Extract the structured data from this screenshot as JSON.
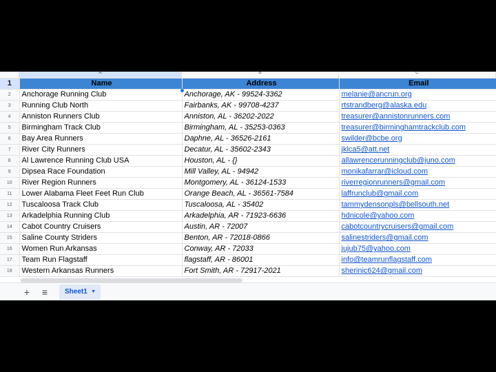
{
  "columns": {
    "a": "A",
    "b": "B",
    "c": "C"
  },
  "header": {
    "row": "1",
    "name": "Name",
    "address": "Address",
    "email": "Email"
  },
  "rows": [
    {
      "n": "2",
      "name": "Anchorage Running Club",
      "address": "Anchorage, AK - 99524-3362",
      "email": "melanie@ancrun.org"
    },
    {
      "n": "3",
      "name": "Running Club North",
      "address": "Fairbanks, AK - 99708-4237",
      "email": "rtstrandberg@alaska.edu"
    },
    {
      "n": "4",
      "name": "Anniston Runners Club",
      "address": "Anniston, AL - 36202-2022",
      "email": "treasurer@annistonrunners.com"
    },
    {
      "n": "5",
      "name": "Birmingham Track Club",
      "address": "Birmingham, AL - 35253-0363",
      "email": "treasurer@birminghamtrackclub.com"
    },
    {
      "n": "6",
      "name": "Bay Area Runners",
      "address": "Daphne, AL - 36526-2161",
      "email": "swilder@bcbe.org"
    },
    {
      "n": "7",
      "name": "River City Runners",
      "address": "Decatur, AL - 35602-2343",
      "email": "jklca5@att.net"
    },
    {
      "n": "8",
      "name": "Al Lawrence Running Club USA",
      "address": "Houston, AL - {}",
      "email": "allawrencerunningclub@juno.com"
    },
    {
      "n": "9",
      "name": "Dipsea Race Foundation",
      "address": "Mill Valley, AL - 94942",
      "email": "monikafarrar@icloud.com"
    },
    {
      "n": "10",
      "name": "River Region Runners",
      "address": "Montgomery, AL - 36124-1533",
      "email": "riverregionrunners@gmail.com"
    },
    {
      "n": "11",
      "name": "Lower Alabama Fleet Feet Run Club",
      "address": "Orange Beach, AL - 36561-7584",
      "email": "laffrunclub@gmail.com"
    },
    {
      "n": "12",
      "name": "Tuscaloosa Track Club",
      "address": "Tuscaloosa, AL - 35402",
      "email": "tammydensonpls@bellsouth.net"
    },
    {
      "n": "13",
      "name": "Arkadelphia Running Club",
      "address": "Arkadelphia, AR - 71923-6636",
      "email": "hdnicole@yahoo.com"
    },
    {
      "n": "14",
      "name": "Cabot Country Cruisers",
      "address": "Austin, AR - 72007",
      "email": "cabotcountrycruisers@gmail.com"
    },
    {
      "n": "15",
      "name": "Saline County Striders",
      "address": "Benton, AR - 72018-0866",
      "email": "salinestriders@gmail.com"
    },
    {
      "n": "16",
      "name": "Women Run Arkansas",
      "address": "Conway, AR - 72033",
      "email": "jujub75@yahoo.com"
    },
    {
      "n": "17",
      "name": "Team Run Flagstaff",
      "address": "flagstaff, AR - 86001",
      "email": "info@teamrunflagstaff.com"
    },
    {
      "n": "18",
      "name": "Western Arkansas Runners",
      "address": "Fort Smith, AR - 72917-2021",
      "email": "sherinic624@gmail.com"
    }
  ],
  "sheetbar": {
    "add_icon": "plus-icon",
    "list_icon": "menu-icon",
    "tab_label": "Sheet1",
    "tab_caret_icon": "caret-down-icon"
  },
  "colors": {
    "header_fill": "#3c84d4",
    "link": "#1155cc",
    "selection": "#d3e3fd"
  }
}
